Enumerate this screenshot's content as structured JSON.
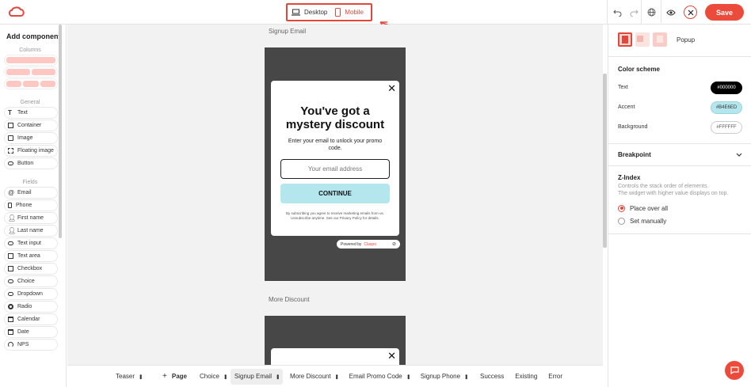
{
  "toolbar": {
    "device_desktop": "Desktop",
    "device_mobile": "Mobile",
    "save_label": "Save"
  },
  "sidebar": {
    "title": "Add component",
    "columns_label": "Columns",
    "general_label": "General",
    "general_items": [
      "Text",
      "Container",
      "Image",
      "Floating image",
      "Button"
    ],
    "fields_label": "Fields",
    "field_items": [
      "Email",
      "Phone",
      "First name",
      "Last name",
      "Text input",
      "Text area",
      "Checkbox",
      "Choice",
      "Dropdown",
      "Radio",
      "Calendar",
      "Date",
      "NPS"
    ]
  },
  "canvas": {
    "frame1_label": "Signup Email",
    "frame2_label": "More Discount",
    "popup": {
      "close": "✕",
      "title_line1": "You've got a",
      "title_line2": "mystery discount",
      "subtitle": "Enter your email to unlock your promo code.",
      "email_placeholder": "Your email address",
      "button_label": "CONTINUE",
      "fine_print": "By subscribing you agree to receive marketing emails from us. Unsubscribe anytime. See our Privacy Policy for details."
    },
    "powered_by": "Powered by",
    "powered_brand": "Claspo"
  },
  "bottom_tabs": [
    "Teaser",
    "Page",
    "Choice",
    "Signup Email",
    "More Discount",
    "Email Promo Code",
    "Signup Phone",
    "Success",
    "Existing",
    "Error"
  ],
  "right_panel": {
    "popup_label": "Popup",
    "color_scheme_title": "Color scheme",
    "colors": [
      {
        "label": "Text",
        "value": "#000000"
      },
      {
        "label": "Accent",
        "value": "#B4E6ED"
      },
      {
        "label": "Background",
        "value": "#FFFFFF"
      }
    ],
    "breakpoint_title": "Breakpoint",
    "zindex_title": "Z-Index",
    "zindex_desc_line1": "Controls the stack order of elements.",
    "zindex_desc_line2": "The widget with higher value displays on top.",
    "option_place_over": "Place over all",
    "option_set_manually": "Set manually"
  },
  "colors": {
    "accent": "#ec4a3a",
    "highlight": "#e1483b",
    "popup_button": "#b4e6ed"
  }
}
